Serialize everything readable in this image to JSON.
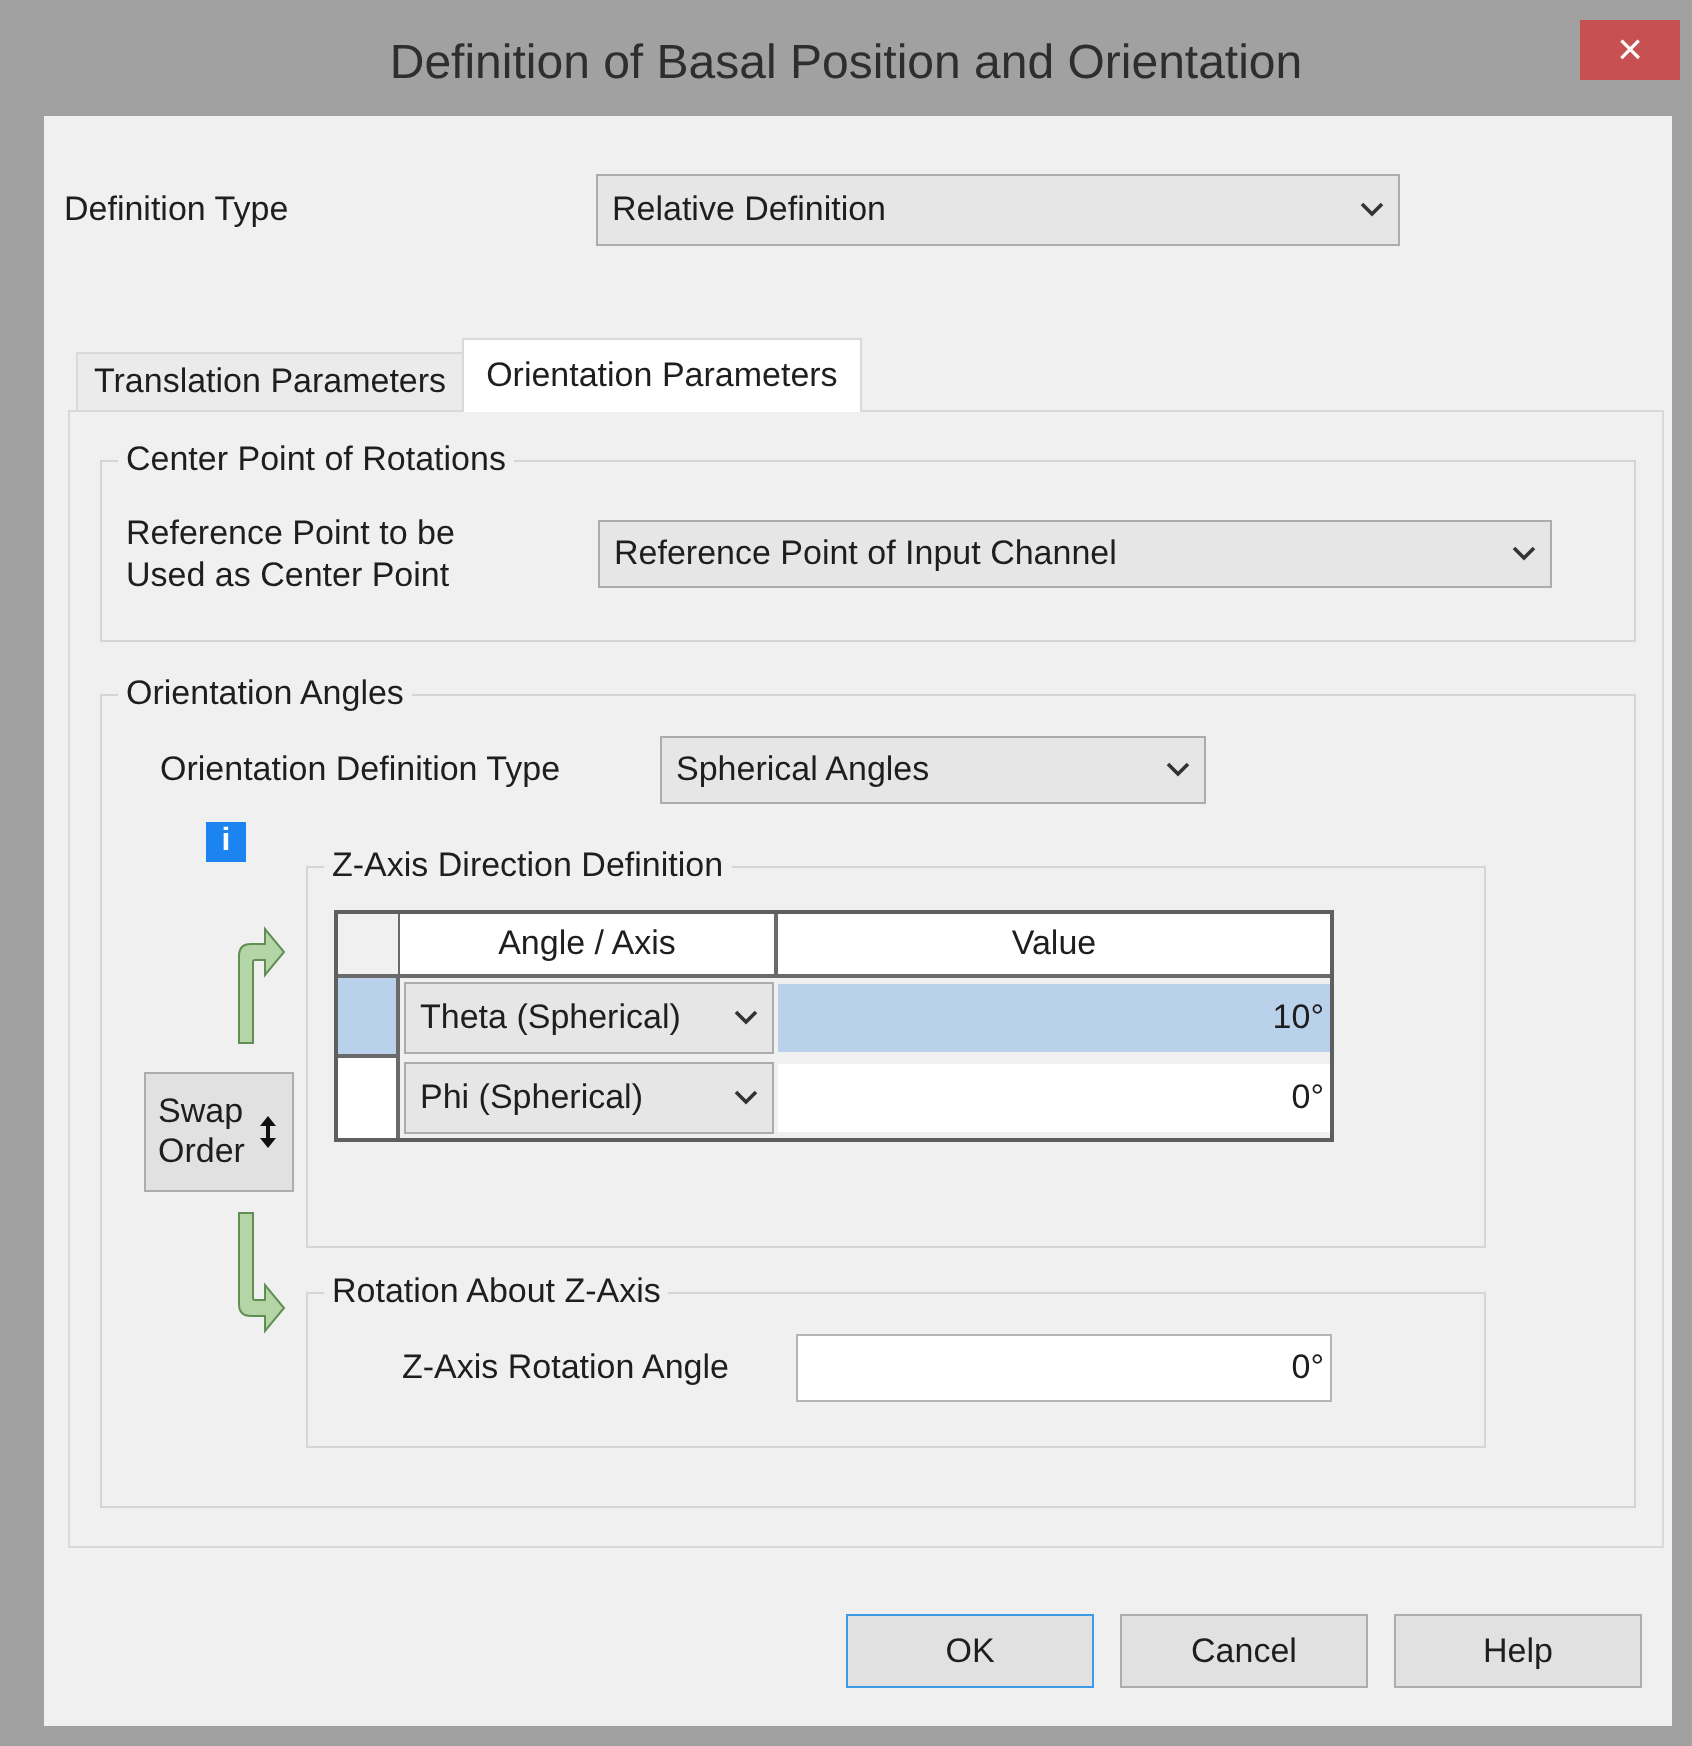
{
  "window": {
    "title": "Definition of Basal Position and Orientation",
    "close": "×"
  },
  "definition_type": {
    "label": "Definition Type",
    "value": "Relative Definition"
  },
  "tabs": [
    {
      "label": "Translation Parameters",
      "selected": false
    },
    {
      "label": "Orientation Parameters",
      "selected": true
    }
  ],
  "center_point_group": {
    "title": "Center Point of Rotations",
    "label": "Reference Point to be Used as Center Point",
    "value": "Reference Point of Input Channel"
  },
  "orientation_angles_group": {
    "title": "Orientation Angles",
    "type_label": "Orientation Definition Type",
    "type_value": "Spherical Angles",
    "info": "i",
    "z_axis_direction": {
      "title": "Z-Axis Direction Definition",
      "columns": [
        "Angle / Axis",
        "Value"
      ],
      "rows": [
        {
          "angle": "Theta (Spherical)",
          "value": "10°",
          "selected": true
        },
        {
          "angle": "Phi (Spherical)",
          "value": "0°",
          "selected": false
        }
      ]
    },
    "swap_button": "Swap Order",
    "rotation": {
      "title": "Rotation About Z-Axis",
      "label": "Z-Axis Rotation Angle",
      "value": "0°"
    }
  },
  "buttons": [
    {
      "label": "OK",
      "default": true
    },
    {
      "label": "Cancel",
      "default": false
    },
    {
      "label": "Help",
      "default": false
    }
  ]
}
